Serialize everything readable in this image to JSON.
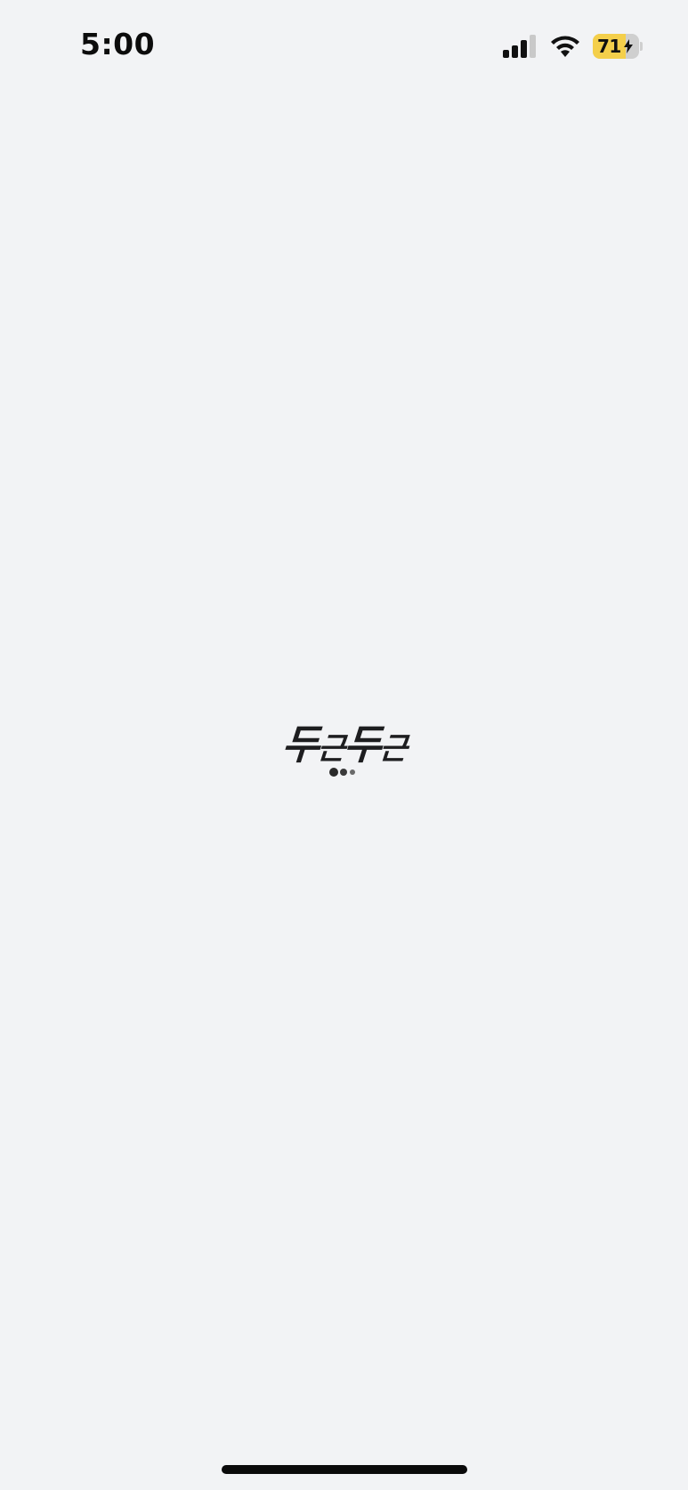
{
  "status_bar": {
    "time": "5:00",
    "battery_level_percent": 71,
    "battery_label": "71",
    "charging": true,
    "signal_icon": "cellular-signal-icon",
    "wifi_icon": "wifi-icon",
    "battery_color": "#f4cf4b"
  },
  "splash": {
    "logo_text_part1": "두",
    "logo_text_part2": "근",
    "logo_text_part3": "두",
    "logo_text_part4": "근",
    "loading_indicator": "loading-dots-icon"
  },
  "colors": {
    "background": "#f2f3f5",
    "logo": "#1d1d1f"
  }
}
